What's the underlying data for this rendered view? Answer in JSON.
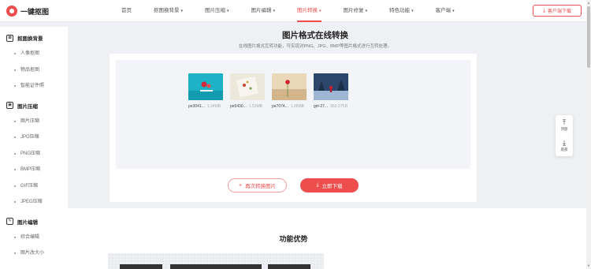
{
  "brand": {
    "name": "一键抠图"
  },
  "nav": {
    "items": [
      {
        "label": "首页",
        "caret": false,
        "active": false
      },
      {
        "label": "抠图换背景",
        "caret": true,
        "active": false
      },
      {
        "label": "图片压缩",
        "caret": true,
        "active": false
      },
      {
        "label": "图片编辑",
        "caret": true,
        "active": false
      },
      {
        "label": "图片转换",
        "caret": true,
        "active": true
      },
      {
        "label": "图片修复",
        "caret": true,
        "active": false
      },
      {
        "label": "特色功能",
        "caret": true,
        "active": false
      },
      {
        "label": "客户端",
        "caret": true,
        "active": false
      }
    ],
    "download_client": "客户端下载"
  },
  "sidebar": {
    "groups": [
      {
        "title": "抠图换背景",
        "icon": "image-cutout-icon",
        "items": [
          "人像抠图",
          "物品抠图",
          "智能证件照"
        ]
      },
      {
        "title": "图片压缩",
        "icon": "image-compress-icon",
        "items": [
          "图片压缩",
          "JPG压缩",
          "PNG压缩",
          "BMP压缩",
          "GIF压缩",
          "JPEG压缩"
        ]
      },
      {
        "title": "图片编辑",
        "icon": "image-edit-icon",
        "items": [
          "综合编辑",
          "图片改大小"
        ]
      }
    ]
  },
  "main": {
    "title": "图片格式在线转换",
    "subtitle": "在线图片格式互转功能，可实现对PNG、JPG、BMP等图片格式进行互转处理。",
    "files": [
      {
        "name": "pe3041...",
        "size": "1.04MB",
        "colors": [
          "#1fb0c4",
          "#0e7e96"
        ]
      },
      {
        "name": "pe5430...",
        "size": "1.53MB",
        "colors": [
          "#e9e5d8",
          "#c9d2c0"
        ]
      },
      {
        "name": "pe7074...",
        "size": "1.05MB",
        "colors": [
          "#e7d6b5",
          "#cdb088"
        ]
      },
      {
        "name": "girl-27...",
        "size": "953.37KB",
        "colors": [
          "#2d4a6e",
          "#7fa0c4"
        ]
      }
    ],
    "convert_again": "再次转换图片",
    "download_now": "立即下载"
  },
  "advantages": {
    "title": "功能优势"
  },
  "float_tools": {
    "top": "顶部",
    "bottom": "底部"
  },
  "colors": {
    "accent": "#ee4d4d"
  }
}
